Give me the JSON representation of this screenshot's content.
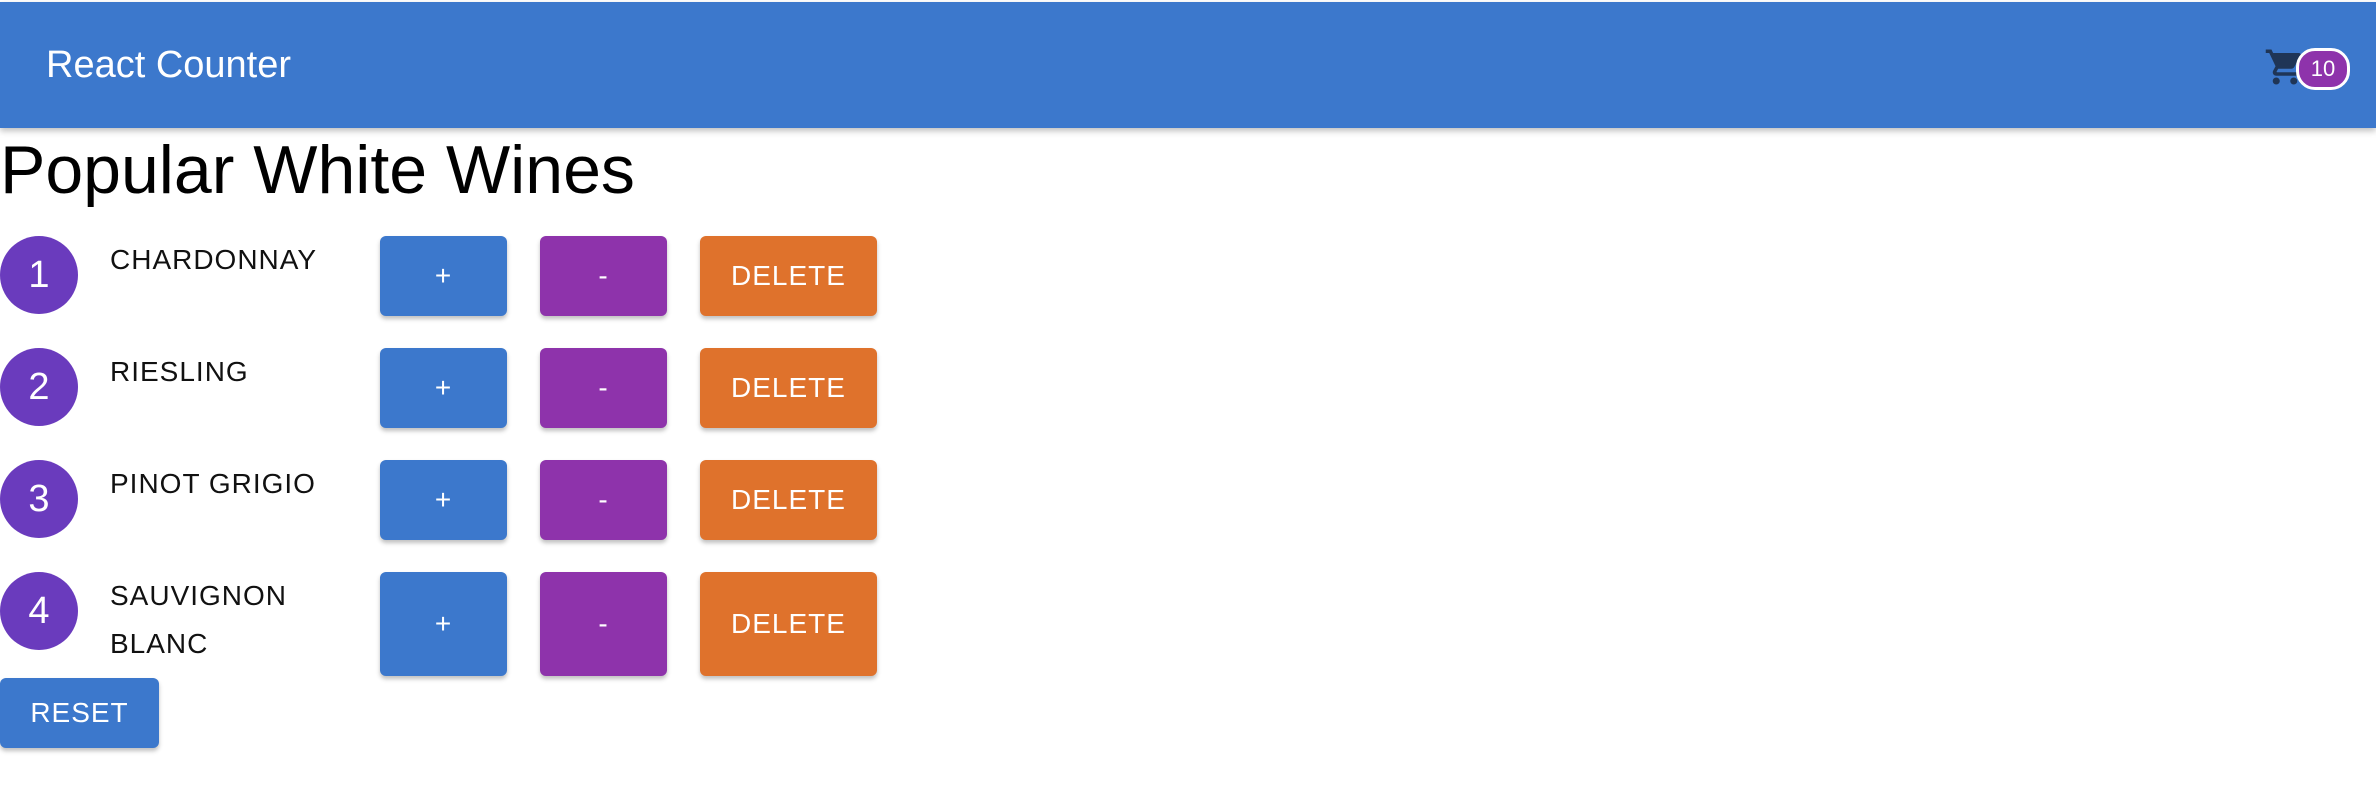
{
  "app": {
    "title": "React Counter",
    "cart_count": "10",
    "colors": {
      "primary": "#3c78cc",
      "secondary": "#8e33ab",
      "danger": "#df722c",
      "avatar": "#6a3bbd"
    }
  },
  "page": {
    "title": "Popular White Wines"
  },
  "wines": [
    {
      "index": "1",
      "name": "CHARDONNAY"
    },
    {
      "index": "2",
      "name": "RIESLING"
    },
    {
      "index": "3",
      "name": "PINOT GRIGIO"
    },
    {
      "index": "4",
      "name": "SAUVIGNON BLANC"
    }
  ],
  "buttons": {
    "increment": "+",
    "decrement": "-",
    "delete": "DELETE",
    "reset": "RESET"
  }
}
